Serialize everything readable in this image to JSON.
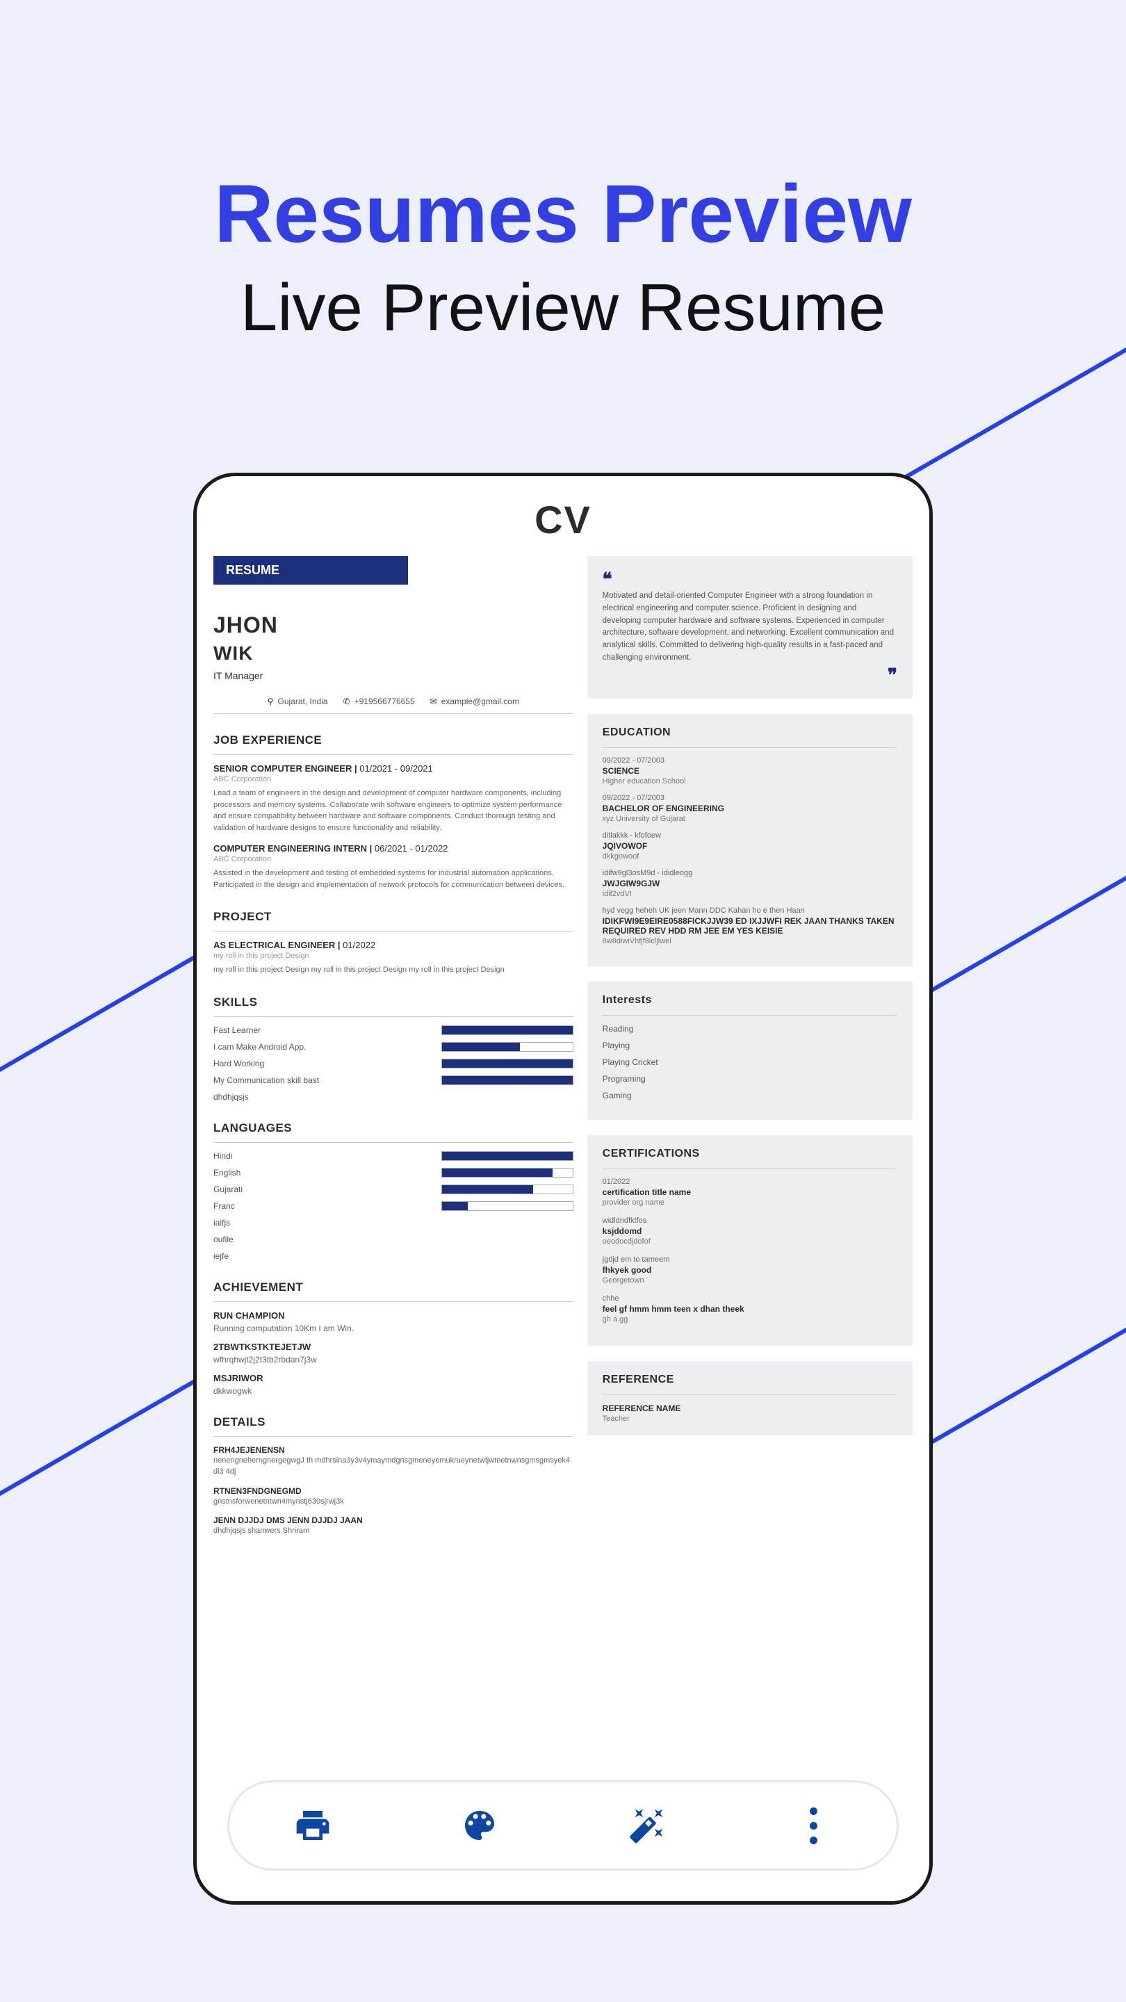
{
  "hero": {
    "title": "Resumes Preview",
    "subtitle": "Live Preview Resume"
  },
  "header": {
    "cv": "CV"
  },
  "badge": "RESUME",
  "profile": {
    "first": "JHON",
    "last": "WIK",
    "job": "IT Manager",
    "location": "Gujarat, India",
    "phone": "+919566776655",
    "email": "example@gmail.com"
  },
  "sections": {
    "experience": "JOB EXPERIENCE",
    "project": "PROJECT",
    "skills": "SKILLS",
    "languages": "LANGUAGES",
    "achievement": "ACHIEVEMENT",
    "details": "DETAILS",
    "education": "EDUCATION",
    "interests": "Interests",
    "certifications": "CERTIFICATIONS",
    "reference": "REFERENCE"
  },
  "experience": [
    {
      "title": "SENIOR COMPUTER ENGINEER",
      "dates": "01/2021 - 09/2021",
      "company": "ABC Corporation",
      "desc": "Lead a team of engineers in the design and development of computer hardware components, including processors and memory systems. Collaborate with software engineers to optimize system performance and ensure compatibility between hardware and software components. Conduct thorough testing and validation of hardware designs to ensure functionality and reliability."
    },
    {
      "title": "COMPUTER ENGINEERING INTERN",
      "dates": "06/2021 - 01/2022",
      "company": "ABC Corporation",
      "desc": "Assisted in the development and testing of embedded systems for industrial automation applications. Participated in the design and implementation of network protocols for communication between devices."
    }
  ],
  "project": {
    "title": "AS ELECTRICAL ENGINEER",
    "dates": "01/2022",
    "role": "my roll in this project Design",
    "desc": "my roll in this project Design my roll in this project Design my roll in this project Design"
  },
  "skills": [
    {
      "name": "Fast Learner",
      "pct": 100
    },
    {
      "name": "I cam Make Android App.",
      "pct": 60
    },
    {
      "name": "Hard Working",
      "pct": 100
    },
    {
      "name": "My Communication skill bast",
      "pct": 100
    },
    {
      "name": "dhdhjqsjs",
      "pct": 0
    }
  ],
  "languages": [
    {
      "name": "Hindi",
      "pct": 100
    },
    {
      "name": "English",
      "pct": 85
    },
    {
      "name": "Gujarati",
      "pct": 70
    },
    {
      "name": "Franc",
      "pct": 20
    },
    {
      "name": "iaifjs",
      "pct": 0
    },
    {
      "name": "oufile",
      "pct": 0
    },
    {
      "name": "iejfe",
      "pct": 0
    }
  ],
  "achievements": [
    {
      "title": "RUN CHAMPION",
      "desc": "Running computation 10Km I am Win."
    },
    {
      "title": "2TBWTKSTKTEJETJW",
      "desc": "wfhrqhwjt2j2t3tb2rbdan7j3w"
    },
    {
      "title": "MSJRIWOR",
      "desc": "dkkwogwk"
    }
  ],
  "details": [
    {
      "title": "FRH4JEJENENSN",
      "desc": "nenengneherngnergegwgJ th mdhrsina3y3v4ymaymdgnsgmeneyemukrueynetwtjwtnetnwnsgmsgmsyek4di3 4dj"
    },
    {
      "title": "RTNEN3FNDGNEGMD",
      "desc": "gnstnsforwenetntwn4mynstj630sjrwj3k"
    },
    {
      "title": "JENN DJJDJ DMS JENN DJJDJ JAAN",
      "desc": "dhdhjqsjs shanwers Shriram"
    }
  ],
  "summary": "Motivated and detail-oriented Computer Engineer with a strong foundation in electrical engineering and computer science. Proficient in designing and developing computer hardware and software systems. Experienced in computer architecture, software development, and networking. Excellent communication and analytical skills. Committed to delivering high-quality results in a fast-paced and challenging environment.",
  "education": [
    {
      "date": "09/2022 - 07/2003",
      "degree": "SCIENCE",
      "school": "Higher education School"
    },
    {
      "date": "09/2022 - 07/2003",
      "degree": "BACHELOR OF ENGINEERING",
      "school": "xyz University of Gujarat"
    },
    {
      "date": "ditlakkk - kfofoew",
      "degree": "JQIVOWOF",
      "school": "dkkgowoof"
    },
    {
      "date": "idifw9gl3osM9d - ididleogg",
      "degree": "JWJGIW9GJW",
      "school": "idif2vdVI"
    },
    {
      "date": "hyd vegg heheh UK jeen Mann DDC Kahan ho e then Haan",
      "degree": "IDIKFWI9E9EIRE0588FICKJJW39 ED IXJJWFI REK JAAN THANKS TAKEN REQUIRED REV HDD RM JEE EM YES KEISIE",
      "school": "8w8diwiVhfjf8icljlwel"
    }
  ],
  "interests": [
    "Reading",
    "Playing",
    "Playing Cricket",
    "Programing",
    "Gaming"
  ],
  "certifications": [
    {
      "date": "01/2022",
      "name": "certification title name",
      "org": "provider org name"
    },
    {
      "date": "widldndfktfos",
      "name": "ksjddomd",
      "org": "oeodocdjdofof"
    },
    {
      "date": "jgdjd em to tameem",
      "name": "fhkyek good",
      "org": "Georgetown"
    },
    {
      "date": "chhe",
      "name": "feel gf hmm hmm teen x dhan theek",
      "org": "gh a gg"
    }
  ],
  "reference": {
    "name": "REFERENCE NAME",
    "role": "Teacher"
  }
}
